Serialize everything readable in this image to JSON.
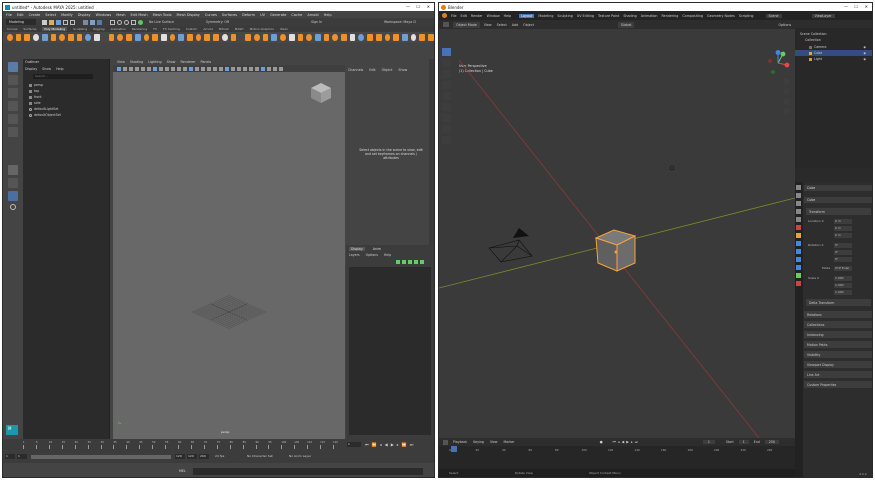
{
  "maya": {
    "title": "untitled* - Autodesk MAYA 2025: untitled",
    "menus": [
      "File",
      "Edit",
      "Create",
      "Select",
      "Modify",
      "Display",
      "Windows",
      "Mesh",
      "Edit Mesh",
      "Mesh Tools",
      "Mesh Display",
      "Curves",
      "Surfaces",
      "Deform",
      "UV",
      "Generate",
      "Cache",
      "Arnold",
      "Help"
    ],
    "workspace_label": "Workspace: Maya Cl",
    "mode": "Modeling",
    "shelf_tabs": [
      "Curves",
      "Surfaces",
      "Poly Modeling",
      "Sculpting",
      "Rigging",
      "Animation",
      "Rendering",
      "FX",
      "FX Caching",
      "Custom",
      "Arnold",
      "Bifrost",
      "MASH",
      "Motion Graphics",
      "XGen"
    ],
    "no_live_surface": "No Live Surface",
    "symmetry": "Symmetry: Off",
    "sign_in": "Sign In",
    "outliner": {
      "title": "Outliner",
      "menus": [
        "Display",
        "Show",
        "Help"
      ],
      "search_placeholder": "Search...",
      "items": [
        "persp",
        "top",
        "front",
        "side",
        "defaultLightSet",
        "defaultObjectSet"
      ]
    },
    "viewport_menus": [
      "View",
      "Shading",
      "Lighting",
      "Show",
      "Renderer",
      "Panels"
    ],
    "viewport_label": "persp",
    "attr": {
      "menus": [
        "Channels",
        "Edit",
        "Object",
        "Show"
      ],
      "hint": "Select objects in the scene to view, edit and set keyframes on channels / attributes",
      "layer_tabs": [
        "Display",
        "Anim"
      ],
      "layer_menus": [
        "Layers",
        "Options",
        "Help"
      ]
    },
    "timeline_ticks": [
      "1",
      "5",
      "10",
      "15",
      "20",
      "25",
      "30",
      "35",
      "40",
      "45",
      "50",
      "55",
      "60",
      "65",
      "70",
      "75",
      "80",
      "85",
      "90",
      "95",
      "100",
      "105",
      "110",
      "115",
      "120"
    ],
    "current_frame": "1",
    "range_start": "1",
    "range_start2": "1",
    "range_end": "120",
    "range_end2": "120",
    "range_end3": "200",
    "char_set": "No Character Set",
    "anim_layer": "No Anim Layer",
    "fps": "24 fps",
    "mel_label": "MEL"
  },
  "blender": {
    "title": "Blender",
    "menus": [
      "File",
      "Edit",
      "Render",
      "Window",
      "Help"
    ],
    "workspaces": [
      "Layout",
      "Modeling",
      "Sculpting",
      "UV Editing",
      "Texture Paint",
      "Shading",
      "Animation",
      "Rendering",
      "Compositing",
      "Geometry Nodes",
      "Scripting"
    ],
    "scene": "Scene",
    "view_layer": "ViewLayer",
    "mode": "Object Mode",
    "viewport_menus": [
      "View",
      "Select",
      "Add",
      "Object"
    ],
    "orientation": "Global",
    "options": "Options",
    "overlay_line1": "User Perspective",
    "overlay_line2": "(1) Collection | Cube",
    "outliner": {
      "root": "Scene Collection",
      "collection": "Collection",
      "items": [
        "Camera",
        "Cube",
        "Light"
      ]
    },
    "props": {
      "object": "Cube",
      "data": "Cube",
      "transform": "Transform",
      "location_label": "Location X",
      "location": [
        "0 m",
        "0 m",
        "0 m"
      ],
      "rotation_label": "Rotation X",
      "rotation": [
        "0°",
        "0°",
        "0°"
      ],
      "mode_label": "Mode",
      "mode_value": "XYZ Euler",
      "scale_label": "Scale X",
      "scale": [
        "1.000",
        "1.000",
        "1.000"
      ],
      "delta": "Delta Transform",
      "sections": [
        "Relations",
        "Collections",
        "Instancing",
        "Motion Paths",
        "Visibility",
        "Viewport Display",
        "Line Art",
        "Custom Properties"
      ]
    },
    "timeline": {
      "menus": [
        "Playback",
        "Keying",
        "View",
        "Marker"
      ],
      "frame": "1",
      "start_label": "Start",
      "start": "1",
      "end_label": "End",
      "end": "250",
      "ticks": [
        "0",
        "20",
        "40",
        "60",
        "80",
        "100",
        "120",
        "140",
        "160",
        "180",
        "200",
        "220",
        "240"
      ]
    },
    "status": {
      "select": "Select",
      "rotate": "Rotate View",
      "menu": "Object Context Menu",
      "version": "4.0.2"
    }
  },
  "colors": {
    "maya_bg": "#444444",
    "maya_viewport": "#686868",
    "blender_bg": "#303030",
    "blender_accent": "#4772b3",
    "selection_orange": "#f5a33c",
    "shelf_orange": "#f0902a"
  }
}
